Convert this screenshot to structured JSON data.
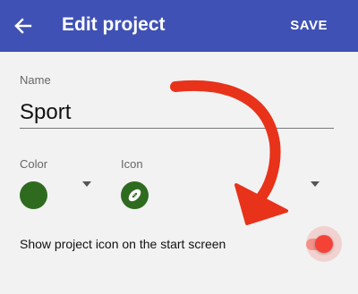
{
  "appbar": {
    "title": "Edit project",
    "save_label": "SAVE",
    "back_icon": "arrow-left-icon",
    "color": "#3f51b5"
  },
  "form": {
    "name_label": "Name",
    "name_value": "Sport",
    "color_label": "Color",
    "icon_label": "Icon",
    "selected_color": "#2e6b1f",
    "selected_icon": "football-icon",
    "show_icon_label": "Show project icon on the start screen",
    "show_icon_enabled": true,
    "toggle_color": "#f44336"
  },
  "annotation": {
    "arrow_color": "#e8321a"
  }
}
